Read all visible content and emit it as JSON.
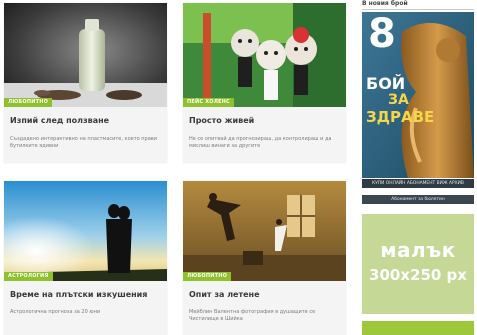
{
  "cards": [
    {
      "tag": "ЛЮБОПИТНО",
      "title": "Изпий след ползване",
      "desc": "Създадено интерактивно на пластмасите, което прави бутилките ядивни"
    },
    {
      "tag": "ПЕЙС ХОЛЕНС",
      "title": "Просто живей",
      "desc": "Не се опитвай да прогнозираш, да контролираш и да мислиш винаги за другите"
    },
    {
      "tag": "АСТРОЛОГИЯ",
      "title": "Време на плътски изкушения",
      "desc": "Астрологична прогноза за 20 юни"
    },
    {
      "tag": "ЛЮБОПИТНО",
      "title": "Опит за летене",
      "desc": "Мейблин Валентна фотография в душащите се Чистилище в Шийка"
    }
  ],
  "sidebar": {
    "section_label": "В новия брой",
    "cover": {
      "logo": "8",
      "headline_1": "БОЙ",
      "headline_2": "ЗА",
      "headline_3": "ЗДРАВЕ"
    },
    "bar_links": "КУПИ ОНЛАЙН   АБОНАМЕНТ   ВИЖ АРХИВ",
    "subscribe_label": "Абонамент за бюлетин",
    "ad_line_1": "малък",
    "ad_line_2": "300x250 px"
  },
  "colors": {
    "accent_green": "#8ec12c",
    "card_bg": "#f4f4f4",
    "ad_bg": "#c5d896",
    "cover_bar": "#2f3c45"
  }
}
